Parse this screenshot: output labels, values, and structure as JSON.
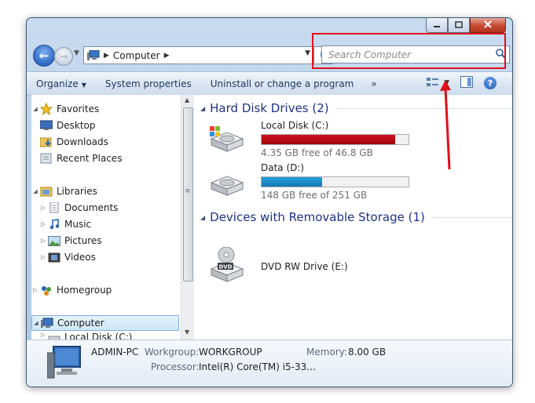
{
  "colors": {
    "accent": "#1e3287",
    "annotation": "#e0101a",
    "drive_c_fill": "#d2101c",
    "drive_d_fill": "#26a0da"
  },
  "titlebar": {
    "minimize_icon": "minimize-icon",
    "maximize_icon": "maximize-icon",
    "close_icon": "close-icon"
  },
  "address": {
    "location": "Computer",
    "icon": "computer-icon"
  },
  "search": {
    "placeholder": "Search Computer",
    "icon": "search-icon"
  },
  "toolbar": {
    "organize": "Organize",
    "system_properties": "System properties",
    "uninstall": "Uninstall or change a program",
    "more": "»"
  },
  "nav": {
    "favorites": "Favorites",
    "desktop": "Desktop",
    "downloads": "Downloads",
    "recent_places": "Recent Places",
    "libraries": "Libraries",
    "documents": "Documents",
    "music": "Music",
    "pictures": "Pictures",
    "videos": "Videos",
    "homegroup": "Homegroup",
    "computer": "Computer",
    "local_disk": "Local Disk (C:)"
  },
  "groups": {
    "hdd": "Hard Disk Drives (2)",
    "removable": "Devices with Removable Storage (1)"
  },
  "drives": [
    {
      "name": "Local Disk (C:)",
      "free_text": "4.35 GB free of 46.8 GB",
      "used_fraction": 0.907
    },
    {
      "name": "Data (D:)",
      "free_text": "148 GB free of 251 GB",
      "used_fraction": 0.41
    }
  ],
  "removable": [
    {
      "name": "DVD RW Drive (E:)",
      "badge": "DVD"
    }
  ],
  "details": {
    "computer_name": "ADMIN-PC",
    "workgroup_label": "Workgroup:",
    "workgroup_value": "WORKGROUP",
    "memory_label": "Memory:",
    "memory_value": "8.00 GB",
    "processor_label": "Processor:",
    "processor_value": "Intel(R) Core(TM) i5-33..."
  }
}
